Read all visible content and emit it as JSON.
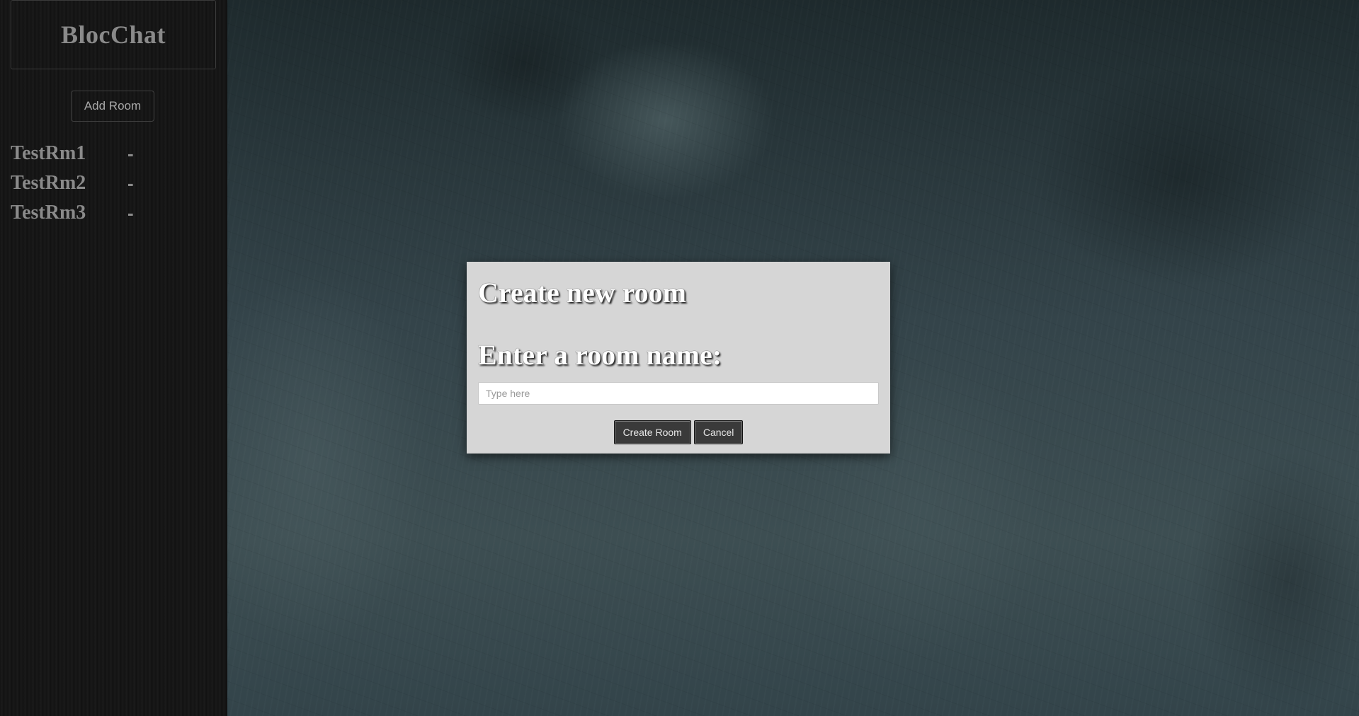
{
  "sidebar": {
    "brand_title": "BlocChat",
    "add_room_label": "Add Room",
    "rooms": [
      {
        "name": "TestRm1",
        "remove_label": "-"
      },
      {
        "name": "TestRm2",
        "remove_label": "-"
      },
      {
        "name": "TestRm3",
        "remove_label": "-"
      }
    ]
  },
  "modal": {
    "title": "Create new room",
    "input_label": "Enter a room name:",
    "input_placeholder": "Type here",
    "input_value": "",
    "create_label": "Create Room",
    "cancel_label": "Cancel"
  },
  "colors": {
    "sidebar_bg": "#151515",
    "sidebar_text": "#8a8a8a",
    "modal_bg": "#d6d6d6",
    "button_bg": "#3a3a3a"
  }
}
